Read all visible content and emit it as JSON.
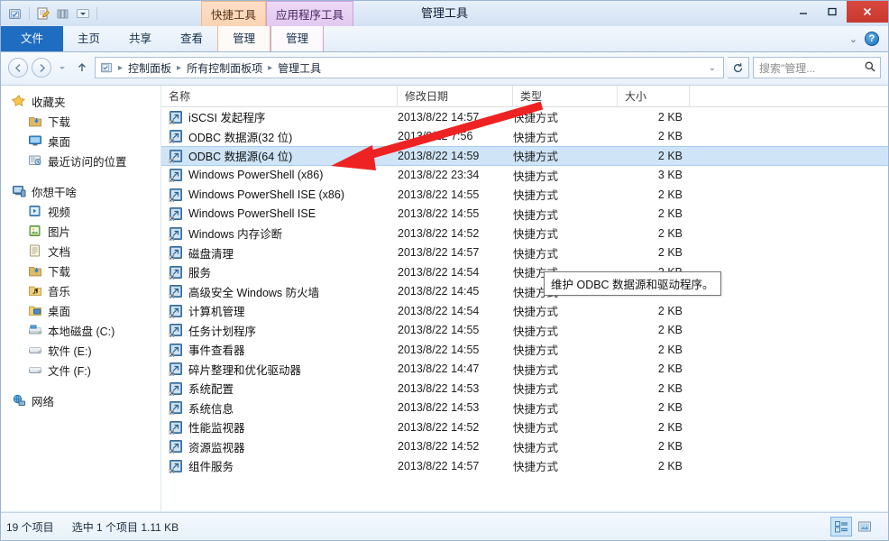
{
  "window": {
    "title": "管理工具",
    "controls": {
      "minimize": "—",
      "maximize": "❐",
      "close": "✕"
    }
  },
  "quick_access": {
    "items": [
      {
        "name": "folder-properties-icon",
        "glyph": ""
      },
      {
        "name": "new-folder-icon",
        "glyph": ""
      },
      {
        "name": "view-icon",
        "glyph": ""
      },
      {
        "name": "customize-dropdown-icon",
        "glyph": "▾"
      }
    ]
  },
  "contextual_tabs": [
    {
      "label": "快捷工具",
      "kind": "quick",
      "accent": "#f0b98c"
    },
    {
      "label": "应用程序工具",
      "kind": "app",
      "accent": "#c9a3de"
    }
  ],
  "ribbon": {
    "tabs": [
      {
        "label": "文件",
        "selected": true
      },
      {
        "label": "主页",
        "selected": false
      },
      {
        "label": "共享",
        "selected": false
      },
      {
        "label": "查看",
        "selected": false
      },
      {
        "label": "管理",
        "selected": false,
        "group": "quick"
      },
      {
        "label": "管理",
        "selected": false,
        "group": "app"
      }
    ],
    "collapse_label": "⌄",
    "help_label": "?"
  },
  "address": {
    "back": "←",
    "forward": "→",
    "history": "▾",
    "up": "↑",
    "breadcrumbs": [
      "控制面板",
      "所有控制面板项",
      "管理工具"
    ],
    "separator": "▸",
    "dropdown": "⌄",
    "refresh": "↻"
  },
  "search": {
    "placeholder": "搜索\"管理...",
    "icon": "search-icon"
  },
  "sidebar": {
    "groups": [
      {
        "header": {
          "label": "收藏夹",
          "icon": "star-icon"
        },
        "items": [
          {
            "label": "下载",
            "icon": "downloads-icon"
          },
          {
            "label": "桌面",
            "icon": "desktop-icon"
          },
          {
            "label": "最近访问的位置",
            "icon": "recent-places-icon"
          }
        ]
      },
      {
        "header": {
          "label": "你想干啥",
          "icon": "computer-icon"
        },
        "items": [
          {
            "label": "视频",
            "icon": "videos-icon"
          },
          {
            "label": "图片",
            "icon": "pictures-icon"
          },
          {
            "label": "文档",
            "icon": "documents-icon"
          },
          {
            "label": "下载",
            "icon": "downloads-icon"
          },
          {
            "label": "音乐",
            "icon": "music-icon"
          },
          {
            "label": "桌面",
            "icon": "desktop-folder-icon"
          },
          {
            "label": "本地磁盘 (C:)",
            "icon": "system-drive-icon"
          },
          {
            "label": "软件 (E:)",
            "icon": "drive-icon"
          },
          {
            "label": "文件 (F:)",
            "icon": "drive-icon"
          }
        ]
      },
      {
        "header": {
          "label": "网络",
          "icon": "network-icon"
        },
        "items": []
      }
    ]
  },
  "columns": [
    {
      "label": "名称",
      "key": "name"
    },
    {
      "label": "修改日期",
      "key": "date"
    },
    {
      "label": "类型",
      "key": "type"
    },
    {
      "label": "大小",
      "key": "size"
    }
  ],
  "files": [
    {
      "name": "iSCSI 发起程序",
      "date": "2013/8/22 14:57",
      "type": "快捷方式",
      "size": "2 KB",
      "selected": false
    },
    {
      "name": "ODBC 数据源(32 位)",
      "date": "2013/8/22 7:56",
      "type": "快捷方式",
      "size": "2 KB",
      "selected": false
    },
    {
      "name": "ODBC 数据源(64 位)",
      "date": "2013/8/22 14:59",
      "type": "快捷方式",
      "size": "2 KB",
      "selected": true
    },
    {
      "name": "Windows PowerShell (x86)",
      "date": "2013/8/22 23:34",
      "type": "快捷方式",
      "size": "3 KB",
      "selected": false
    },
    {
      "name": "Windows PowerShell ISE (x86)",
      "date": "2013/8/22 14:55",
      "type": "快捷方式",
      "size": "2 KB",
      "selected": false
    },
    {
      "name": "Windows PowerShell ISE",
      "date": "2013/8/22 14:55",
      "type": "快捷方式",
      "size": "2 KB",
      "selected": false
    },
    {
      "name": "Windows 内存诊断",
      "date": "2013/8/22 14:52",
      "type": "快捷方式",
      "size": "2 KB",
      "selected": false
    },
    {
      "name": "磁盘清理",
      "date": "2013/8/22 14:57",
      "type": "快捷方式",
      "size": "2 KB",
      "selected": false
    },
    {
      "name": "服务",
      "date": "2013/8/22 14:54",
      "type": "快捷方式",
      "size": "2 KB",
      "selected": false
    },
    {
      "name": "高级安全 Windows 防火墙",
      "date": "2013/8/22 14:45",
      "type": "快捷方式",
      "size": "2 KB",
      "selected": false
    },
    {
      "name": "计算机管理",
      "date": "2013/8/22 14:54",
      "type": "快捷方式",
      "size": "2 KB",
      "selected": false
    },
    {
      "name": "任务计划程序",
      "date": "2013/8/22 14:55",
      "type": "快捷方式",
      "size": "2 KB",
      "selected": false
    },
    {
      "name": "事件查看器",
      "date": "2013/8/22 14:55",
      "type": "快捷方式",
      "size": "2 KB",
      "selected": false
    },
    {
      "name": "碎片整理和优化驱动器",
      "date": "2013/8/22 14:47",
      "type": "快捷方式",
      "size": "2 KB",
      "selected": false
    },
    {
      "name": "系统配置",
      "date": "2013/8/22 14:53",
      "type": "快捷方式",
      "size": "2 KB",
      "selected": false
    },
    {
      "name": "系统信息",
      "date": "2013/8/22 14:53",
      "type": "快捷方式",
      "size": "2 KB",
      "selected": false
    },
    {
      "name": "性能监视器",
      "date": "2013/8/22 14:52",
      "type": "快捷方式",
      "size": "2 KB",
      "selected": false
    },
    {
      "name": "资源监视器",
      "date": "2013/8/22 14:52",
      "type": "快捷方式",
      "size": "2 KB",
      "selected": false
    },
    {
      "name": "组件服务",
      "date": "2013/8/22 14:57",
      "type": "快捷方式",
      "size": "2 KB",
      "selected": false
    }
  ],
  "tooltip": {
    "text": "维护 ODBC 数据源和驱动程序。"
  },
  "annotation": {
    "color": "#ee2222",
    "shape": "arrow",
    "points": "from (600,118) to (368,183)"
  },
  "status": {
    "item_count": "19 个项目",
    "selection": "选中 1 个项目  1.11 KB",
    "views": [
      {
        "name": "details-view-button",
        "active": true
      },
      {
        "name": "large-icons-view-button",
        "active": false
      }
    ]
  }
}
